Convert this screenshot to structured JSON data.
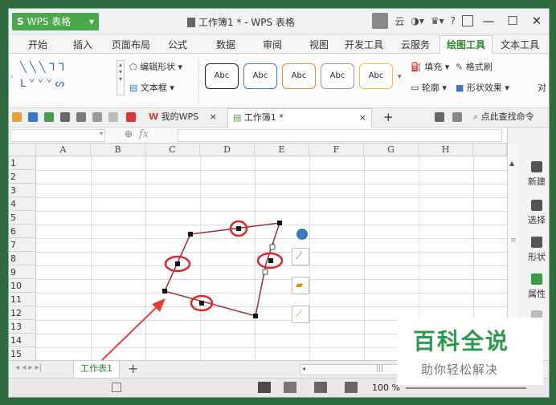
{
  "titlebar": {
    "app_label": "WPS 表格",
    "app_caret": "▾",
    "doc_title": "工作簿1 * - WPS 表格",
    "cloud": "云",
    "help": "?",
    "min": "—",
    "max": "☐",
    "close": "✕"
  },
  "menu": {
    "tabs": [
      "开始",
      "插入",
      "页面布局",
      "公式",
      "数据",
      "审阅",
      "视图",
      "开发工具",
      "云服务",
      "绘图工具",
      "文本工具"
    ],
    "active_index": 9
  },
  "ribbon": {
    "edit_shape": "编辑形状 ▾",
    "textbox": "文本框 ▾",
    "abc_label": "Abc",
    "fill": "填充 ▾",
    "format_brush": "格式刷",
    "outline": "轮廓 ▾",
    "shape_effects": "形状效果 ▾",
    "right_cut": "对"
  },
  "quickbar": {
    "my_wps": "我的WPS",
    "doc_tab": "工作簿1 *",
    "tab_close": "×",
    "add": "+",
    "search": "点此查找命令"
  },
  "formula": {
    "fx": "fx"
  },
  "sheet": {
    "columns": [
      "A",
      "B",
      "C",
      "D",
      "E",
      "F",
      "G",
      "H"
    ],
    "rows": [
      "1",
      "2",
      "3",
      "4",
      "5",
      "6",
      "7",
      "8",
      "9",
      "10",
      "11",
      "12",
      "13",
      "14",
      "15"
    ]
  },
  "right_panel": {
    "items": [
      "新建",
      "选择",
      "形状",
      "属性"
    ]
  },
  "sheet_tabs": {
    "sheet_name": "工作表1",
    "add": "+",
    "nav": "◂ ◂ ▸ ▸|"
  },
  "status": {
    "zoom": "100 %"
  },
  "watermark": {
    "title": "百科全说",
    "subtitle": "助你轻松解决"
  },
  "colors": {
    "accent": "#49a84c",
    "selection_circle": "#d9262b",
    "arrow": "#e63c36"
  }
}
